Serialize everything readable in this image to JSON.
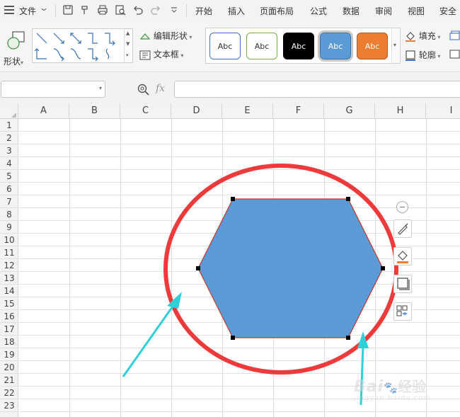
{
  "menubar": {
    "file_label": "文件",
    "tabs": [
      "开始",
      "插入",
      "页面布局",
      "公式",
      "数据",
      "审阅",
      "视图",
      "安全"
    ]
  },
  "ribbon": {
    "shapes_label": "形状",
    "edit_shape_label": "编辑形状",
    "text_box_label": "文本框",
    "fill_label": "填充",
    "outline_label": "轮廓",
    "style_swatches": [
      {
        "text": "Abc",
        "fill": "#ffffff",
        "border": "#4472c4",
        "color": "#333333"
      },
      {
        "text": "Abc",
        "fill": "#ffffff",
        "border": "#70ad47",
        "color": "#333333"
      },
      {
        "text": "Abc",
        "fill": "#000000",
        "border": "#000000",
        "color": "#ffffff"
      },
      {
        "text": "Abc",
        "fill": "#5b9bd5",
        "border": "#41719c",
        "color": "#ffffff"
      },
      {
        "text": "Abc",
        "fill": "#ed7d31",
        "border": "#ae5a21",
        "color": "#ffffff"
      }
    ]
  },
  "formula_bar": {
    "name_box_value": "",
    "fx_label": "fx",
    "formula_value": ""
  },
  "sheet": {
    "columns": [
      "A",
      "B",
      "C",
      "D",
      "E",
      "F",
      "G",
      "H",
      "I"
    ],
    "rows": [
      "1",
      "2",
      "3",
      "4",
      "5",
      "6",
      "7",
      "8",
      "9",
      "10",
      "11",
      "12",
      "13",
      "14",
      "15",
      "16",
      "17",
      "18",
      "19",
      "20",
      "21",
      "22",
      "23"
    ]
  },
  "shape": {
    "type": "hexagon",
    "fill": "#5b9bd5",
    "stroke": "#c0392b"
  },
  "annotations": {
    "circle_color": "#ee3a3a",
    "arrow_color": "#2fd0d8"
  },
  "floating_toolbar": [
    "collapse-icon",
    "shape-style-brush-icon",
    "fill-bucket-icon",
    "outline-icon",
    "layout-options-icon"
  ],
  "watermark": {
    "brand": "Bai",
    "brand2": "经验",
    "url": "jingyan.baidu.com"
  }
}
